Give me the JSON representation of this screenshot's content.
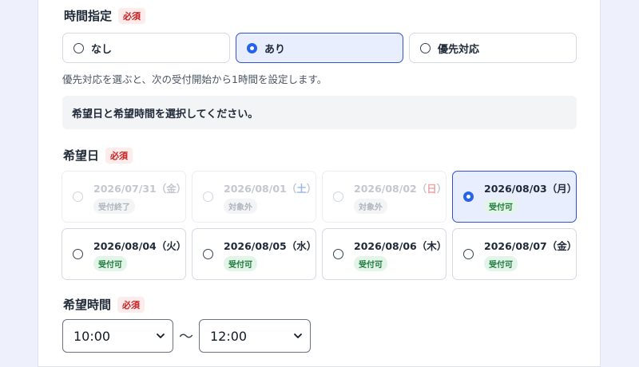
{
  "time_spec": {
    "label": "時間指定",
    "required": "必須",
    "options": [
      {
        "label": "なし",
        "selected": false
      },
      {
        "label": "あり",
        "selected": true
      },
      {
        "label": "優先対応",
        "selected": false
      }
    ],
    "hint": "優先対応を選ぶと、次の受付開始から1時間を設定します。"
  },
  "notice": "希望日と希望時間を選択してください。",
  "desired_date": {
    "label": "希望日",
    "required": "必須",
    "dates": [
      {
        "date": "2026/07/31",
        "day": "金",
        "status": "受付終了",
        "disabled": true,
        "selected": false
      },
      {
        "date": "2026/08/01",
        "day": "土",
        "status": "対象外",
        "disabled": true,
        "selected": false
      },
      {
        "date": "2026/08/02",
        "day": "日",
        "status": "対象外",
        "disabled": true,
        "selected": false
      },
      {
        "date": "2026/08/03",
        "day": "月",
        "status": "受付可",
        "disabled": false,
        "selected": true
      },
      {
        "date": "2026/08/04",
        "day": "火",
        "status": "受付可",
        "disabled": false,
        "selected": false
      },
      {
        "date": "2026/08/05",
        "day": "水",
        "status": "受付可",
        "disabled": false,
        "selected": false
      },
      {
        "date": "2026/08/06",
        "day": "木",
        "status": "受付可",
        "disabled": false,
        "selected": false
      },
      {
        "date": "2026/08/07",
        "day": "金",
        "status": "受付可",
        "disabled": false,
        "selected": false
      }
    ]
  },
  "desired_time": {
    "label": "希望時間",
    "required": "必須",
    "from": "10:00",
    "separator": "〜",
    "to": "12:00"
  },
  "colors": {
    "accent": "#2563eb",
    "required_badge": "#c81e1e",
    "available_badge": "#1e7a3c",
    "saturday": "#3b6fd6",
    "sunday": "#e05a5a"
  }
}
